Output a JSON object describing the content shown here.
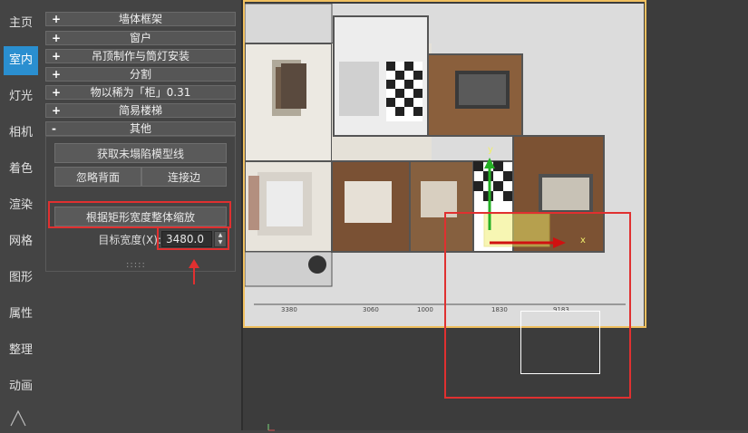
{
  "sidebar": {
    "tabs": [
      {
        "label": "主页"
      },
      {
        "label": "室内"
      },
      {
        "label": "灯光"
      },
      {
        "label": "相机"
      },
      {
        "label": "着色"
      },
      {
        "label": "渲染"
      },
      {
        "label": "网格"
      },
      {
        "label": "图形"
      },
      {
        "label": "属性"
      },
      {
        "label": "整理"
      },
      {
        "label": "动画"
      }
    ],
    "active_tab": "室内"
  },
  "panel": {
    "rollouts": [
      {
        "sign": "+",
        "title": "墙体框架"
      },
      {
        "sign": "+",
        "title": "窗户"
      },
      {
        "sign": "+",
        "title": "吊顶制作与筒灯安装"
      },
      {
        "sign": "+",
        "title": "分割"
      },
      {
        "sign": "+",
        "title": "物以稀为「柜」0.31"
      },
      {
        "sign": "+",
        "title": "简易楼梯"
      },
      {
        "sign": "-",
        "title": "其他"
      }
    ],
    "other": {
      "btn_get_lines": "获取未塌陷模型线",
      "btn_ignore_bg": "忽略背面",
      "btn_connect_edges": "连接边",
      "btn_scale_by_rect": "根据矩形宽度整体缩放",
      "target_width_label": "目标宽度(X):",
      "target_width_value": "3480.0"
    }
  },
  "viewport": {
    "plan_labels": {
      "dims_bottom": [
        "3380",
        "3060",
        "1000",
        "1830",
        "9183"
      ],
      "axis_y": "y",
      "axis_x": "x"
    }
  },
  "colors": {
    "active_tab": "#2a8fd0",
    "highlight": "#e03030",
    "viewport_border": "#f0c060"
  }
}
